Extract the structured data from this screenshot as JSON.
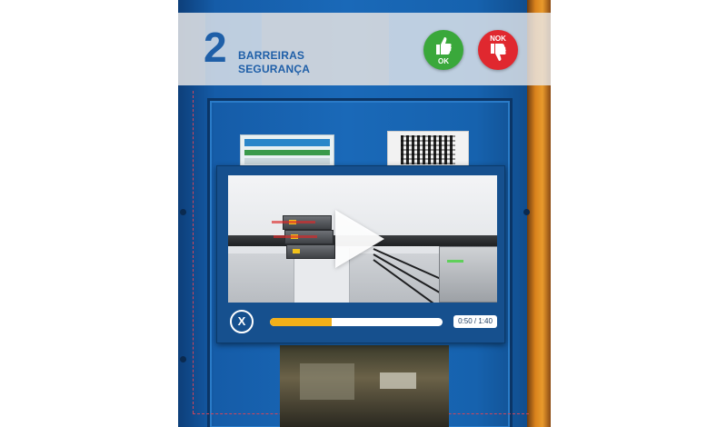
{
  "header": {
    "step_number": "2",
    "title_line1": "BARREIRAS",
    "title_line2": "SEGURANÇA"
  },
  "actions": {
    "ok_label": "OK",
    "nok_label": "NOK"
  },
  "player": {
    "close_label": "X",
    "time": "0:50 / 1:40",
    "progress": 0.36
  },
  "icons": {
    "ok": "thumbs-up-icon",
    "nok": "thumbs-down-icon",
    "play": "play-icon",
    "close": "close-icon"
  },
  "colors": {
    "ok": "#3aa83b",
    "nok": "#e0282f",
    "accent": "#1f5fa8",
    "progress": "#f2b019"
  }
}
